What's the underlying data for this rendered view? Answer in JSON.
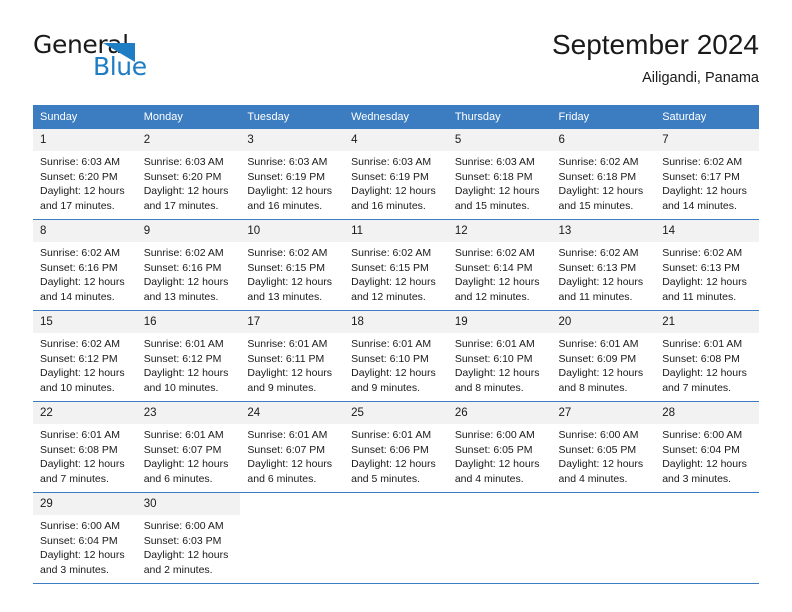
{
  "logo": {
    "word_top": "General",
    "word_bottom": "Blue",
    "triangle_color": "#1f7dc4",
    "text_color": "#1a1a1a"
  },
  "header": {
    "title": "September 2024",
    "subtitle": "Ailigandi, Panama"
  },
  "theme": {
    "header_blue": "#3c7cc0",
    "daynum_gray": "#f2f2f2",
    "text": "#1a1a1a",
    "background": "#ffffff"
  },
  "weekday_headers": [
    "Sunday",
    "Monday",
    "Tuesday",
    "Wednesday",
    "Thursday",
    "Friday",
    "Saturday"
  ],
  "weeks": [
    [
      {
        "day": "1",
        "sunrise": "Sunrise: 6:03 AM",
        "sunset": "Sunset: 6:20 PM",
        "daylight1": "Daylight: 12 hours",
        "daylight2": "and 17 minutes."
      },
      {
        "day": "2",
        "sunrise": "Sunrise: 6:03 AM",
        "sunset": "Sunset: 6:20 PM",
        "daylight1": "Daylight: 12 hours",
        "daylight2": "and 17 minutes."
      },
      {
        "day": "3",
        "sunrise": "Sunrise: 6:03 AM",
        "sunset": "Sunset: 6:19 PM",
        "daylight1": "Daylight: 12 hours",
        "daylight2": "and 16 minutes."
      },
      {
        "day": "4",
        "sunrise": "Sunrise: 6:03 AM",
        "sunset": "Sunset: 6:19 PM",
        "daylight1": "Daylight: 12 hours",
        "daylight2": "and 16 minutes."
      },
      {
        "day": "5",
        "sunrise": "Sunrise: 6:03 AM",
        "sunset": "Sunset: 6:18 PM",
        "daylight1": "Daylight: 12 hours",
        "daylight2": "and 15 minutes."
      },
      {
        "day": "6",
        "sunrise": "Sunrise: 6:02 AM",
        "sunset": "Sunset: 6:18 PM",
        "daylight1": "Daylight: 12 hours",
        "daylight2": "and 15 minutes."
      },
      {
        "day": "7",
        "sunrise": "Sunrise: 6:02 AM",
        "sunset": "Sunset: 6:17 PM",
        "daylight1": "Daylight: 12 hours",
        "daylight2": "and 14 minutes."
      }
    ],
    [
      {
        "day": "8",
        "sunrise": "Sunrise: 6:02 AM",
        "sunset": "Sunset: 6:16 PM",
        "daylight1": "Daylight: 12 hours",
        "daylight2": "and 14 minutes."
      },
      {
        "day": "9",
        "sunrise": "Sunrise: 6:02 AM",
        "sunset": "Sunset: 6:16 PM",
        "daylight1": "Daylight: 12 hours",
        "daylight2": "and 13 minutes."
      },
      {
        "day": "10",
        "sunrise": "Sunrise: 6:02 AM",
        "sunset": "Sunset: 6:15 PM",
        "daylight1": "Daylight: 12 hours",
        "daylight2": "and 13 minutes."
      },
      {
        "day": "11",
        "sunrise": "Sunrise: 6:02 AM",
        "sunset": "Sunset: 6:15 PM",
        "daylight1": "Daylight: 12 hours",
        "daylight2": "and 12 minutes."
      },
      {
        "day": "12",
        "sunrise": "Sunrise: 6:02 AM",
        "sunset": "Sunset: 6:14 PM",
        "daylight1": "Daylight: 12 hours",
        "daylight2": "and 12 minutes."
      },
      {
        "day": "13",
        "sunrise": "Sunrise: 6:02 AM",
        "sunset": "Sunset: 6:13 PM",
        "daylight1": "Daylight: 12 hours",
        "daylight2": "and 11 minutes."
      },
      {
        "day": "14",
        "sunrise": "Sunrise: 6:02 AM",
        "sunset": "Sunset: 6:13 PM",
        "daylight1": "Daylight: 12 hours",
        "daylight2": "and 11 minutes."
      }
    ],
    [
      {
        "day": "15",
        "sunrise": "Sunrise: 6:02 AM",
        "sunset": "Sunset: 6:12 PM",
        "daylight1": "Daylight: 12 hours",
        "daylight2": "and 10 minutes."
      },
      {
        "day": "16",
        "sunrise": "Sunrise: 6:01 AM",
        "sunset": "Sunset: 6:12 PM",
        "daylight1": "Daylight: 12 hours",
        "daylight2": "and 10 minutes."
      },
      {
        "day": "17",
        "sunrise": "Sunrise: 6:01 AM",
        "sunset": "Sunset: 6:11 PM",
        "daylight1": "Daylight: 12 hours",
        "daylight2": "and 9 minutes."
      },
      {
        "day": "18",
        "sunrise": "Sunrise: 6:01 AM",
        "sunset": "Sunset: 6:10 PM",
        "daylight1": "Daylight: 12 hours",
        "daylight2": "and 9 minutes."
      },
      {
        "day": "19",
        "sunrise": "Sunrise: 6:01 AM",
        "sunset": "Sunset: 6:10 PM",
        "daylight1": "Daylight: 12 hours",
        "daylight2": "and 8 minutes."
      },
      {
        "day": "20",
        "sunrise": "Sunrise: 6:01 AM",
        "sunset": "Sunset: 6:09 PM",
        "daylight1": "Daylight: 12 hours",
        "daylight2": "and 8 minutes."
      },
      {
        "day": "21",
        "sunrise": "Sunrise: 6:01 AM",
        "sunset": "Sunset: 6:08 PM",
        "daylight1": "Daylight: 12 hours",
        "daylight2": "and 7 minutes."
      }
    ],
    [
      {
        "day": "22",
        "sunrise": "Sunrise: 6:01 AM",
        "sunset": "Sunset: 6:08 PM",
        "daylight1": "Daylight: 12 hours",
        "daylight2": "and 7 minutes."
      },
      {
        "day": "23",
        "sunrise": "Sunrise: 6:01 AM",
        "sunset": "Sunset: 6:07 PM",
        "daylight1": "Daylight: 12 hours",
        "daylight2": "and 6 minutes."
      },
      {
        "day": "24",
        "sunrise": "Sunrise: 6:01 AM",
        "sunset": "Sunset: 6:07 PM",
        "daylight1": "Daylight: 12 hours",
        "daylight2": "and 6 minutes."
      },
      {
        "day": "25",
        "sunrise": "Sunrise: 6:01 AM",
        "sunset": "Sunset: 6:06 PM",
        "daylight1": "Daylight: 12 hours",
        "daylight2": "and 5 minutes."
      },
      {
        "day": "26",
        "sunrise": "Sunrise: 6:00 AM",
        "sunset": "Sunset: 6:05 PM",
        "daylight1": "Daylight: 12 hours",
        "daylight2": "and 4 minutes."
      },
      {
        "day": "27",
        "sunrise": "Sunrise: 6:00 AM",
        "sunset": "Sunset: 6:05 PM",
        "daylight1": "Daylight: 12 hours",
        "daylight2": "and 4 minutes."
      },
      {
        "day": "28",
        "sunrise": "Sunrise: 6:00 AM",
        "sunset": "Sunset: 6:04 PM",
        "daylight1": "Daylight: 12 hours",
        "daylight2": "and 3 minutes."
      }
    ],
    [
      {
        "day": "29",
        "sunrise": "Sunrise: 6:00 AM",
        "sunset": "Sunset: 6:04 PM",
        "daylight1": "Daylight: 12 hours",
        "daylight2": "and 3 minutes."
      },
      {
        "day": "30",
        "sunrise": "Sunrise: 6:00 AM",
        "sunset": "Sunset: 6:03 PM",
        "daylight1": "Daylight: 12 hours",
        "daylight2": "and 2 minutes."
      },
      {
        "day": "",
        "sunrise": "",
        "sunset": "",
        "daylight1": "",
        "daylight2": ""
      },
      {
        "day": "",
        "sunrise": "",
        "sunset": "",
        "daylight1": "",
        "daylight2": ""
      },
      {
        "day": "",
        "sunrise": "",
        "sunset": "",
        "daylight1": "",
        "daylight2": ""
      },
      {
        "day": "",
        "sunrise": "",
        "sunset": "",
        "daylight1": "",
        "daylight2": ""
      },
      {
        "day": "",
        "sunrise": "",
        "sunset": "",
        "daylight1": "",
        "daylight2": ""
      }
    ]
  ]
}
